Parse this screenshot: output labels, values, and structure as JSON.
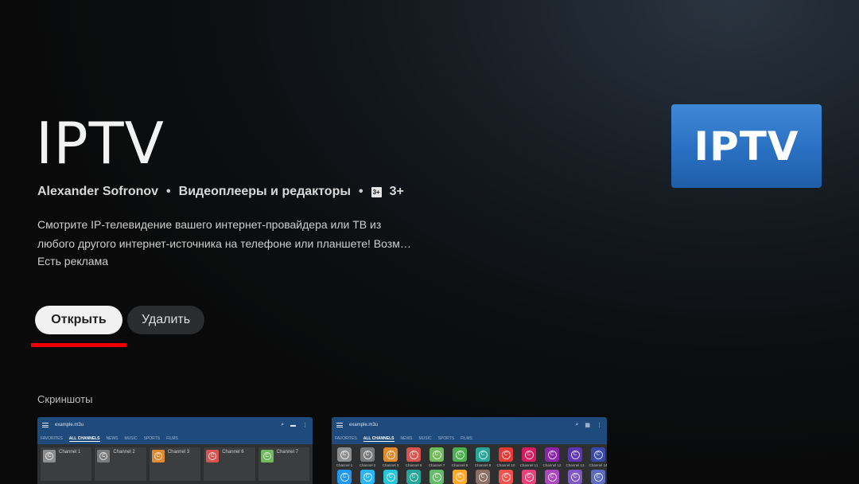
{
  "app": {
    "title": "IPTV",
    "developer": "Alexander Sofronov",
    "category": "Видеоплееры и редакторы",
    "separator": "•",
    "age_rating": "3+",
    "age_badge_glyph": "3+",
    "description_line1": "Смотрите IP-телевидение вашего интернет-провайдера или ТВ из",
    "description_line2": "любого другого интернет-источника на телефоне или планшете! Возм…",
    "ads_note": "Есть реклама",
    "icon_text": "IPTV"
  },
  "actions": {
    "open_label": "Открыть",
    "delete_label": "Удалить",
    "focus_color": "#ee0000"
  },
  "screenshots": {
    "section_title": "Скриншоты",
    "shot1": {
      "url_text": "example.m3u",
      "tabs": [
        "FAVORITES",
        "ALL CHANNELS",
        "NEWS",
        "MUSIC",
        "SPORTS",
        "FILMS"
      ],
      "channels": [
        {
          "name": "Channel 1",
          "color": "#8e8e8e",
          "glyph": "C"
        },
        {
          "name": "Channel 2",
          "color": "#7a7a7a",
          "glyph": "C"
        },
        {
          "name": "Channel 3",
          "color": "#e08a2c",
          "glyph": "C"
        },
        {
          "name": "Channel 6",
          "color": "#d9534f",
          "glyph": "C"
        },
        {
          "name": "Channel 7",
          "color": "#6fba5a",
          "glyph": "C"
        }
      ]
    },
    "shot2": {
      "url_text": "example.m3u",
      "tabs": [
        "FAVORITES",
        "ALL CHANNELS",
        "NEWS",
        "MUSIC",
        "SPORTS",
        "FILMS"
      ],
      "channels": [
        {
          "name": "Channel 1",
          "color": "#8e8e8e"
        },
        {
          "name": "Channel 2",
          "color": "#7a7a7a"
        },
        {
          "name": "Channel 3",
          "color": "#e08a2c"
        },
        {
          "name": "Channel 6",
          "color": "#d9534f"
        },
        {
          "name": "Channel 7",
          "color": "#6fba5a"
        },
        {
          "name": "Channel 8",
          "color": "#4caf50"
        },
        {
          "name": "Channel 9",
          "color": "#26a69a"
        },
        {
          "name": "Channel 10",
          "color": "#e53935"
        },
        {
          "name": "Channel 11",
          "color": "#d81b60"
        },
        {
          "name": "Channel 12",
          "color": "#8e24aa"
        },
        {
          "name": "Channel 13",
          "color": "#5e35b1"
        },
        {
          "name": "Channel 14",
          "color": "#3949ab"
        }
      ],
      "second_row_colors": [
        "#2196f3",
        "#29b6f6",
        "#26c6da",
        "#26a69a",
        "#66bb6a",
        "#ffa726",
        "#8d6e63",
        "#ef5350",
        "#ec407a",
        "#ab47bc",
        "#7e57c2",
        "#5c6bc0"
      ]
    }
  }
}
